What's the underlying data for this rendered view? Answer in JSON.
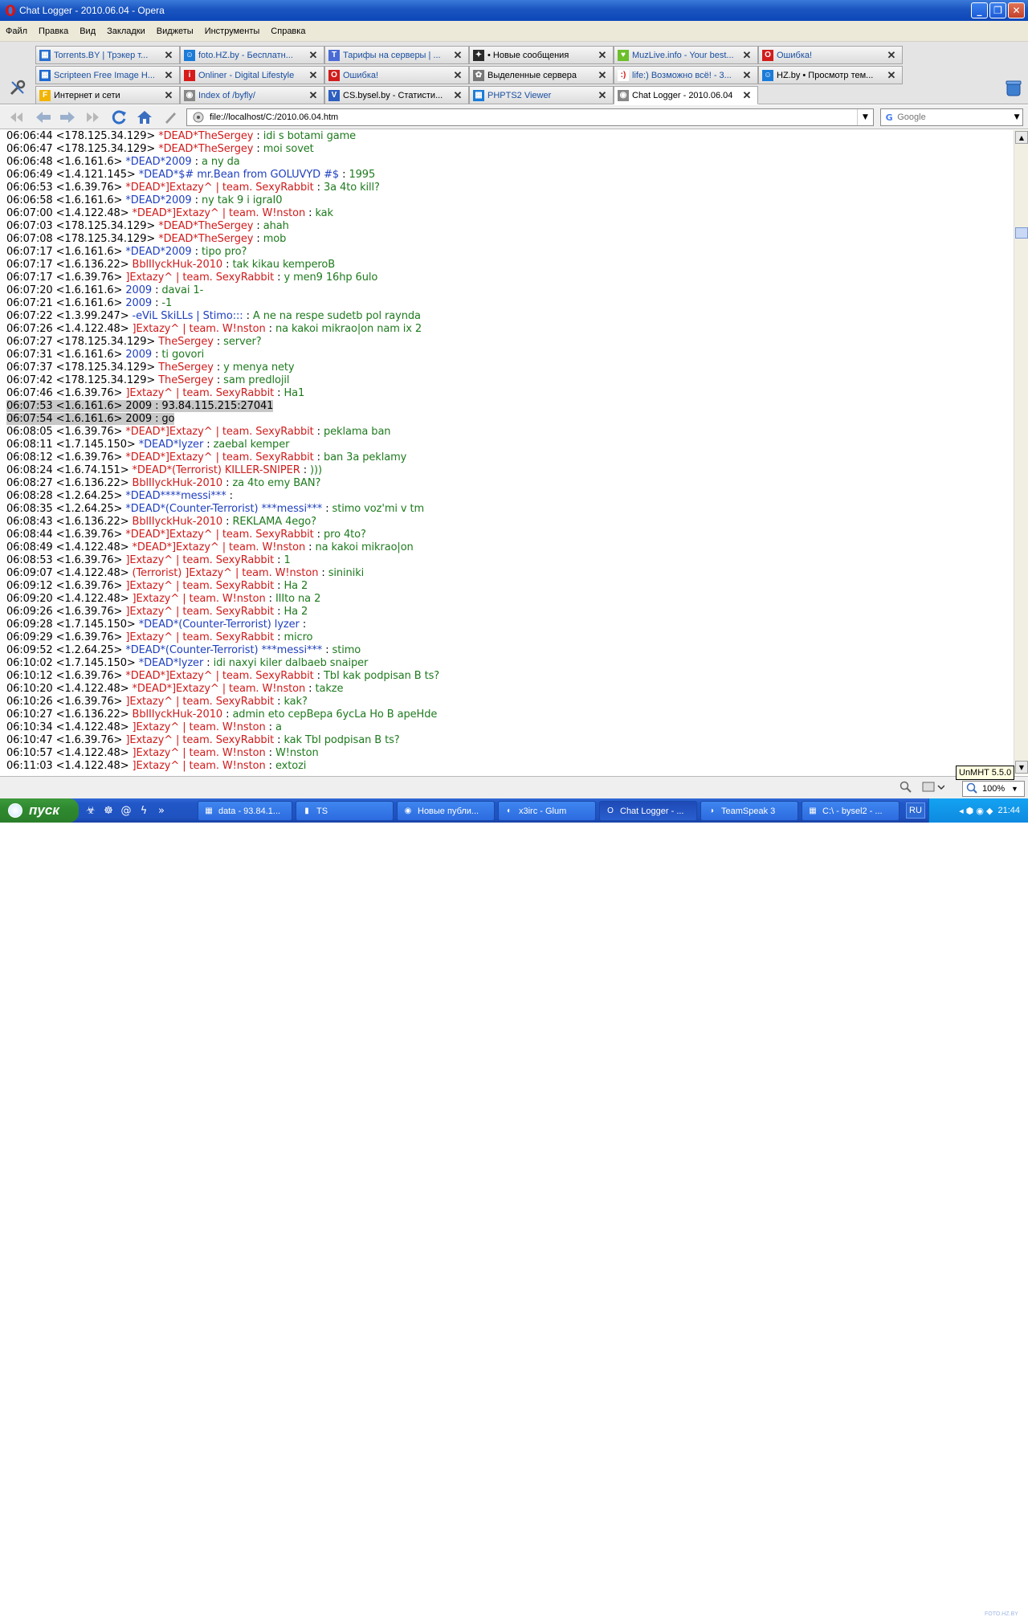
{
  "window": {
    "title": "Chat Logger - 2010.06.04 - Opera"
  },
  "menu": [
    "Файл",
    "Правка",
    "Вид",
    "Закладки",
    "Виджеты",
    "Инструменты",
    "Справка"
  ],
  "tabs": [
    {
      "label": "Torrents.BY | Трэкер т...",
      "icon_color": "#2a6fd0",
      "icon_char": "▦",
      "style": "link"
    },
    {
      "label": "foto.HZ.by - Бесплатн...",
      "icon_color": "#1b7bd8",
      "icon_char": "☺",
      "style": "link"
    },
    {
      "label": "Тарифы на серверы | ...",
      "icon_color": "#4a6bd6",
      "icon_char": "T",
      "style": "link"
    },
    {
      "label": "• Новые сообщения",
      "icon_color": "#2a2a2a",
      "icon_char": "✦",
      "style": "plain"
    },
    {
      "label": "MuzLive.info - Your best...",
      "icon_color": "#6cbf2a",
      "icon_char": "♥",
      "style": "link"
    },
    {
      "label": "Ошибка!",
      "icon_color": "#d21c1c",
      "icon_char": "O",
      "style": "link"
    },
    {
      "label": "Scripteen Free Image H...",
      "icon_color": "#1f6ad0",
      "icon_char": "▦",
      "style": "link"
    },
    {
      "label": "Onliner - Digital Lifestyle",
      "icon_color": "#d71a1a",
      "icon_char": "i",
      "style": "link"
    },
    {
      "label": "Ошибка!",
      "icon_color": "#d21c1c",
      "icon_char": "O",
      "style": "link"
    },
    {
      "label": "Выделенные сервера",
      "icon_color": "#777",
      "icon_char": "✿",
      "style": "plain"
    },
    {
      "label": "life:) Возможно всё! - 3...",
      "icon_color": "#ffffff",
      "icon_char": ":)",
      "style": "link"
    },
    {
      "label": "HZ.by • Просмотр тем...",
      "icon_color": "#1b7bd8",
      "icon_char": "☺",
      "style": "plain"
    },
    {
      "label": "Интернет и сети",
      "icon_color": "#f2b400",
      "icon_char": "F",
      "style": "plain"
    },
    {
      "label": "Index of /byfly/",
      "icon_color": "#888",
      "icon_char": "◉",
      "style": "link"
    },
    {
      "label": "CS.bysel.by - Статисти...",
      "icon_color": "#2e5fc0",
      "icon_char": "V",
      "style": "plain"
    },
    {
      "label": "PHPTS2 Viewer",
      "icon_color": "#1b7bd8",
      "icon_char": "▦",
      "style": "link"
    },
    {
      "label": "Chat Logger - 2010.06.04",
      "icon_color": "#888",
      "icon_char": "◉",
      "style": "active"
    }
  ],
  "address": {
    "url": "file://localhost/C:/2010.06.04.htm"
  },
  "search": {
    "engine": "Google"
  },
  "chat": [
    {
      "time": "06:06:44",
      "ip": "<178.125.34.129>",
      "nick": "*DEAD*TheSergey",
      "color": "red",
      "msg": "idi s botami game"
    },
    {
      "time": "06:06:47",
      "ip": "<178.125.34.129>",
      "nick": "*DEAD*TheSergey",
      "color": "red",
      "msg": "moi sovet"
    },
    {
      "time": "06:06:48",
      "ip": "<1.6.161.6>",
      "nick": "*DEAD*2009",
      "color": "blue",
      "msg": "a ny da"
    },
    {
      "time": "06:06:49",
      "ip": "<1.4.121.145>",
      "nick": "*DEAD*$# mr.Bean from GOLUVYD #$",
      "color": "blue",
      "msg": "1995"
    },
    {
      "time": "06:06:53",
      "ip": "<1.6.39.76>",
      "nick": "*DEAD*]Extazy^ | team. SexyRabbit",
      "color": "red",
      "msg": "3a 4to kill?"
    },
    {
      "time": "06:06:58",
      "ip": "<1.6.161.6>",
      "nick": "*DEAD*2009",
      "color": "blue",
      "msg": "ny tak 9 i igraI0"
    },
    {
      "time": "06:07:00",
      "ip": "<1.4.122.48>",
      "nick": "*DEAD*]Extazy^ | team. W!nston",
      "color": "red",
      "msg": "kak"
    },
    {
      "time": "06:07:03",
      "ip": "<178.125.34.129>",
      "nick": "*DEAD*TheSergey",
      "color": "red",
      "msg": "ahah"
    },
    {
      "time": "06:07:08",
      "ip": "<178.125.34.129>",
      "nick": "*DEAD*TheSergey",
      "color": "red",
      "msg": "mob"
    },
    {
      "time": "06:07:17",
      "ip": "<1.6.161.6>",
      "nick": "*DEAD*2009",
      "color": "blue",
      "msg": "tipo pro?"
    },
    {
      "time": "06:07:17",
      "ip": "<1.6.136.22>",
      "nick": "BblIIyckHuk-2010",
      "color": "red",
      "msg": "tak kikau kemperoB"
    },
    {
      "time": "06:07:17",
      "ip": "<1.6.39.76>",
      "nick": "]Extazy^ | team. SexyRabbit",
      "color": "red",
      "msg": "y men9 16hp 6ulo"
    },
    {
      "time": "06:07:20",
      "ip": "<1.6.161.6>",
      "nick": "2009",
      "color": "blue",
      "msg": "davai 1-"
    },
    {
      "time": "06:07:21",
      "ip": "<1.6.161.6>",
      "nick": "2009",
      "color": "blue",
      "msg": "-1"
    },
    {
      "time": "06:07:22",
      "ip": "<1.3.99.247>",
      "nick": "-eViL SkiLLs | Stimo:::",
      "color": "blue",
      "msg": "A ne na respe sudetb pol raynda"
    },
    {
      "time": "06:07:26",
      "ip": "<1.4.122.48>",
      "nick": "]Extazy^ | team. W!nston",
      "color": "red",
      "msg": "na kakoi mikrao|on nam ix 2"
    },
    {
      "time": "06:07:27",
      "ip": "<178.125.34.129>",
      "nick": "TheSergey",
      "color": "red",
      "msg": "server?"
    },
    {
      "time": "06:07:31",
      "ip": "<1.6.161.6>",
      "nick": "2009",
      "color": "blue",
      "msg": "ti govori"
    },
    {
      "time": "06:07:37",
      "ip": "<178.125.34.129>",
      "nick": "TheSergey",
      "color": "red",
      "msg": "y menya nety"
    },
    {
      "time": "06:07:42",
      "ip": "<178.125.34.129>",
      "nick": "TheSergey",
      "color": "red",
      "msg": "sam predlojil"
    },
    {
      "time": "06:07:46",
      "ip": "<1.6.39.76>",
      "nick": "]Extazy^ | team. SexyRabbit",
      "color": "red",
      "msg": "Ha1"
    },
    {
      "time": "06:07:53",
      "ip": "<1.6.161.6>",
      "nick": "2009",
      "color": "blue",
      "msg": "93.84.115.215:27041",
      "selected": true
    },
    {
      "time": "06:07:54",
      "ip": "<1.6.161.6>",
      "nick": "2009",
      "color": "blue",
      "msg": "go",
      "selected": true
    },
    {
      "time": "06:08:05",
      "ip": "<1.6.39.76>",
      "nick": "*DEAD*]Extazy^ | team. SexyRabbit",
      "color": "red",
      "msg": "peklama ban"
    },
    {
      "time": "06:08:11",
      "ip": "<1.7.145.150>",
      "nick": "*DEAD*lyzer",
      "color": "blue",
      "msg": "zaebal kemper"
    },
    {
      "time": "06:08:12",
      "ip": "<1.6.39.76>",
      "nick": "*DEAD*]Extazy^ | team. SexyRabbit",
      "color": "red",
      "msg": "ban 3a peklamy"
    },
    {
      "time": "06:08:24",
      "ip": "<1.6.74.151>",
      "nick": "*DEAD*(Terrorist) KILLER-SNIPER",
      "color": "red",
      "msg": ")))"
    },
    {
      "time": "06:08:27",
      "ip": "<1.6.136.22>",
      "nick": "BblIIyckHuk-2010",
      "color": "red",
      "msg": "za 4to emy BAN?"
    },
    {
      "time": "06:08:28",
      "ip": "<1.2.64.25>",
      "nick": "*DEAD****messi***",
      "color": "blue",
      "msg": ""
    },
    {
      "time": "06:08:35",
      "ip": "<1.2.64.25>",
      "nick": "*DEAD*(Counter-Terrorist) ***messi***",
      "color": "blue",
      "msg": "stimo voz'mi v tm"
    },
    {
      "time": "06:08:43",
      "ip": "<1.6.136.22>",
      "nick": "BblIIyckHuk-2010",
      "color": "red",
      "msg": "REKLAMA 4ego?"
    },
    {
      "time": "06:08:44",
      "ip": "<1.6.39.76>",
      "nick": "*DEAD*]Extazy^ | team. SexyRabbit",
      "color": "red",
      "msg": "pro 4to?"
    },
    {
      "time": "06:08:49",
      "ip": "<1.4.122.48>",
      "nick": "*DEAD*]Extazy^ | team. W!nston",
      "color": "red",
      "msg": "na kakoi mikrao|on"
    },
    {
      "time": "06:08:53",
      "ip": "<1.6.39.76>",
      "nick": "]Extazy^ | team. SexyRabbit",
      "color": "red",
      "msg": "1"
    },
    {
      "time": "06:09:07",
      "ip": "<1.4.122.48>",
      "nick": "(Terrorist) ]Extazy^ | team. W!nston",
      "color": "red",
      "msg": "sininiki"
    },
    {
      "time": "06:09:12",
      "ip": "<1.6.39.76>",
      "nick": "]Extazy^ | team. SexyRabbit",
      "color": "red",
      "msg": "Ha 2"
    },
    {
      "time": "06:09:20",
      "ip": "<1.4.122.48>",
      "nick": "]Extazy^ | team. W!nston",
      "color": "red",
      "msg": "IIIto na 2"
    },
    {
      "time": "06:09:26",
      "ip": "<1.6.39.76>",
      "nick": "]Extazy^ | team. SexyRabbit",
      "color": "red",
      "msg": "Ha 2"
    },
    {
      "time": "06:09:28",
      "ip": "<1.7.145.150>",
      "nick": "*DEAD*(Counter-Terrorist) lyzer",
      "color": "blue",
      "msg": ""
    },
    {
      "time": "06:09:29",
      "ip": "<1.6.39.76>",
      "nick": "]Extazy^ | team. SexyRabbit",
      "color": "red",
      "msg": "micro"
    },
    {
      "time": "06:09:52",
      "ip": "<1.2.64.25>",
      "nick": "*DEAD*(Counter-Terrorist) ***messi***",
      "color": "blue",
      "msg": "stimo"
    },
    {
      "time": "06:10:02",
      "ip": "<1.7.145.150>",
      "nick": "*DEAD*lyzer",
      "color": "blue",
      "msg": "idi naxyi kiler dalbaeb snaiper"
    },
    {
      "time": "06:10:12",
      "ip": "<1.6.39.76>",
      "nick": "*DEAD*]Extazy^ | team. SexyRabbit",
      "color": "red",
      "msg": "TbI kak podpisan B ts?"
    },
    {
      "time": "06:10:20",
      "ip": "<1.4.122.48>",
      "nick": "*DEAD*]Extazy^ | team. W!nston",
      "color": "red",
      "msg": "takze"
    },
    {
      "time": "06:10:26",
      "ip": "<1.6.39.76>",
      "nick": "]Extazy^ | team. SexyRabbit",
      "color": "red",
      "msg": "kak?"
    },
    {
      "time": "06:10:27",
      "ip": "<1.6.136.22>",
      "nick": "BblIIyckHuk-2010",
      "color": "red",
      "msg": "admin eto cepBepa 6ycLa Ho B apeHde"
    },
    {
      "time": "06:10:34",
      "ip": "<1.4.122.48>",
      "nick": "]Extazy^ | team. W!nston",
      "color": "red",
      "msg": "a"
    },
    {
      "time": "06:10:47",
      "ip": "<1.6.39.76>",
      "nick": "]Extazy^ | team. SexyRabbit",
      "color": "red",
      "msg": "kak TbI podpisan B ts?"
    },
    {
      "time": "06:10:57",
      "ip": "<1.4.122.48>",
      "nick": "]Extazy^ | team. W!nston",
      "color": "red",
      "msg": "W!nston"
    },
    {
      "time": "06:11:03",
      "ip": "<1.4.122.48>",
      "nick": "]Extazy^ | team. W!nston",
      "color": "red",
      "msg": "extozi"
    }
  ],
  "status": {
    "unmht": "UnMHT 5.5.0",
    "zoom": "100%"
  },
  "taskbar": {
    "start": "пуск",
    "tasks": [
      {
        "label": "data - 93.84.1...",
        "icon": "▦"
      },
      {
        "label": "TS",
        "icon": "▮"
      },
      {
        "label": "Новые публи...",
        "icon": "◉"
      },
      {
        "label": "x3irc - Glum",
        "icon": "◐"
      },
      {
        "label": "Chat Logger - ...",
        "icon": "O",
        "active": true
      },
      {
        "label": "TeamSpeak 3",
        "icon": "◑"
      },
      {
        "label": "C:\\ - bysel2 - ...",
        "icon": "▦"
      }
    ],
    "lang": "RU",
    "clock": "21:44"
  },
  "colors": {
    "nick_red": "#d01b1b",
    "nick_blue": "#1f3fbf",
    "msg_green": "#1e7a1e",
    "selection": "#c8c8c8"
  },
  "watermark": "FOTO.HZ.BY"
}
